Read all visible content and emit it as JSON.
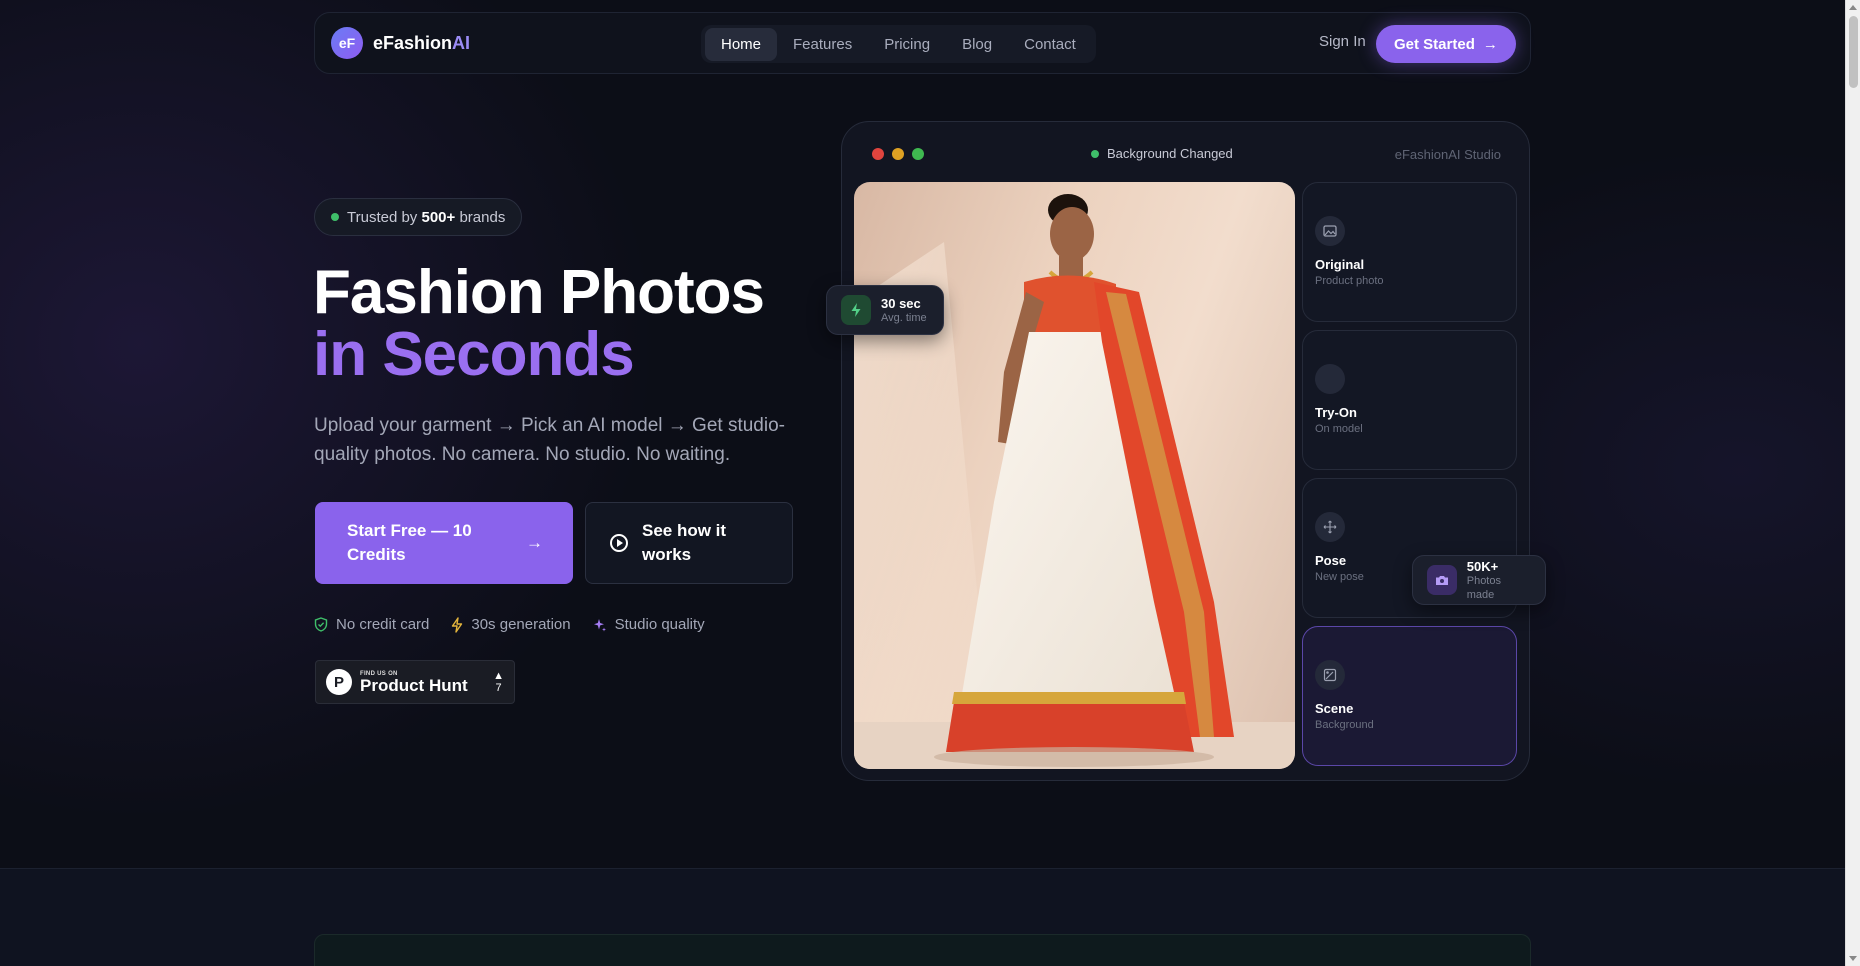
{
  "nav": {
    "logo_mark": "eF",
    "logo_name": "eFashion",
    "logo_suffix": "AI",
    "links": [
      "Home",
      "Features",
      "Pricing",
      "Blog",
      "Contact"
    ],
    "active_link": "Home",
    "sign_in": "Sign In",
    "cta": "Get Started"
  },
  "hero": {
    "trust_prefix": "Trusted by ",
    "trust_count": "500+",
    "trust_suffix": " brands",
    "title_line1": "Fashion Photos",
    "title_line2": "in Seconds",
    "subtitle": "Upload your garment → Pick an AI model → Get studio-quality photos. No camera. No studio. No waiting.",
    "primary_cta": "Start Free — 10 Credits",
    "secondary_cta": "See how it works",
    "features": [
      "No credit card",
      "30s generation",
      "Studio quality"
    ],
    "product_hunt": {
      "small": "FIND US ON",
      "big": "Product Hunt",
      "votes": "7"
    }
  },
  "studio": {
    "status": "Background Changed",
    "label": "eFashionAI Studio",
    "tools": [
      {
        "title": "Original",
        "sub": "Product photo",
        "icon": "image-icon",
        "active": false
      },
      {
        "title": "Try-On",
        "sub": "On model",
        "icon": "person-icon",
        "active": false
      },
      {
        "title": "Pose",
        "sub": "New pose",
        "icon": "move-icon",
        "active": false
      },
      {
        "title": "Scene",
        "sub": "Background",
        "icon": "scene-icon",
        "active": true
      }
    ],
    "badge_time": {
      "title": "30 sec",
      "sub": "Avg. time",
      "icon": "bolt-icon"
    },
    "badge_photos": {
      "title": "50K+",
      "sub": "Photos made",
      "icon": "camera-icon"
    }
  },
  "colors": {
    "accent": "#8a63ec",
    "accent_text": "#9a6ff0",
    "bg": "#0c0e17",
    "status_green": "#3fbf6a"
  }
}
